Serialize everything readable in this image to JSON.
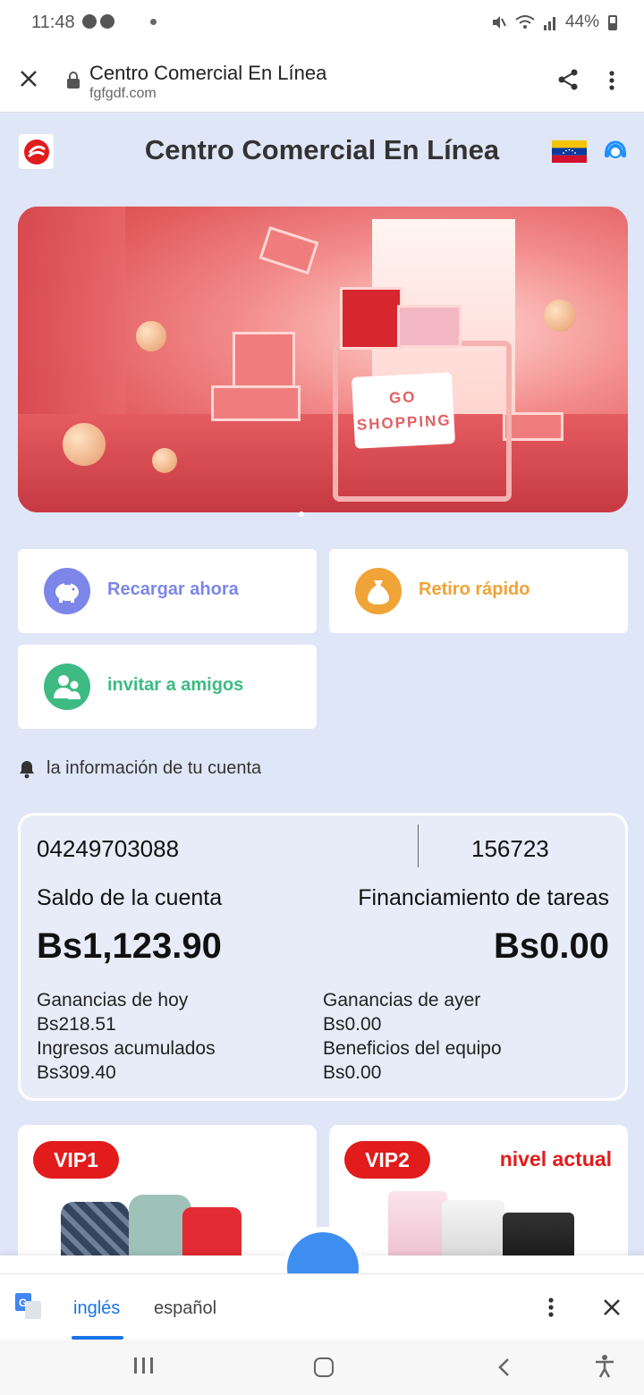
{
  "status_bar": {
    "time": "11:48",
    "battery": "44%"
  },
  "browser": {
    "title": "Centro Comercial En Línea",
    "url": "fgfgdf.com"
  },
  "app": {
    "title": "Centro Comercial En Línea"
  },
  "banner": {
    "sign_line1": "GO",
    "sign_line2": "SHOPPING"
  },
  "actions": {
    "recharge": "Recargar ahora",
    "withdraw": "Retiro rápido",
    "invite": "invitar a amigos"
  },
  "account": {
    "section_title": "la información de tu cuenta",
    "phone": "04249703088",
    "user_id": "156723",
    "balance_label": "Saldo de la cuenta",
    "balance_value": "Bs1,123.90",
    "task_funding_label": "Financiamiento de tareas",
    "task_funding_value": "Bs0.00",
    "today_label": "Ganancias de hoy",
    "today_value": "Bs218.51",
    "accumulated_label": "Ingresos acumulados",
    "accumulated_value": "Bs309.40",
    "yesterday_label": "Ganancias de ayer",
    "yesterday_value": "Bs0.00",
    "team_label": "Beneficios del equipo",
    "team_value": "Bs0.00"
  },
  "vip": [
    {
      "badge": "VIP1",
      "current_label": ""
    },
    {
      "badge": "VIP2",
      "current_label": "nivel actual"
    }
  ],
  "translate_bar": {
    "lang_from": "inglés",
    "lang_to": "español"
  },
  "colors": {
    "recharge": "#7c86e8",
    "withdraw": "#f0a336",
    "invite": "#3dbb82",
    "vip_red": "#e21b1b",
    "page_bg": "#dfe6f7"
  },
  "icons": [
    "close-icon",
    "lock-icon",
    "share-icon",
    "more-vert-icon",
    "piggy-bank-icon",
    "money-bag-icon",
    "friends-icon",
    "bell-icon",
    "venezuela-flag-icon",
    "support-agent-icon",
    "translate-icon"
  ]
}
